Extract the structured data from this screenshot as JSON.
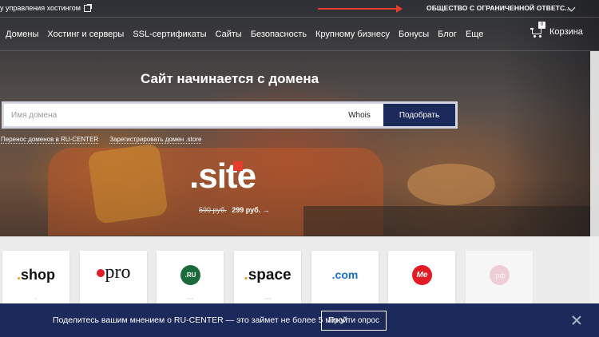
{
  "topbar": {
    "hosting_link": "у управления хостингом",
    "company": "ОБЩЕСТВО С ОГРАНИЧЕННОЙ ОТВЕТС..."
  },
  "nav": {
    "items": [
      "Домены",
      "Хостинг и серверы",
      "SSL-сертификаты",
      "Сайты",
      "Безопасность",
      "Крупному бизнесу",
      "Бонусы",
      "Блог",
      "Еще"
    ],
    "cart_label": "Корзина",
    "cart_count": "0"
  },
  "hero": {
    "headline": "Сайт начинается с домена",
    "search_placeholder": "Имя домена",
    "whois_label": "Whois",
    "pick_button": "Подобрать",
    "links": [
      "Перенос доменов в RU-CENTER",
      "Зарегистрировать домен .store"
    ]
  },
  "promo": {
    "zone_text": ".site",
    "old_price": "590 руб.",
    "new_price": "299 руб. →"
  },
  "tiles": [
    {
      "label": "shop",
      "prefix": "."
    },
    {
      "label": "pro",
      "prefix": ""
    },
    {
      "label": ".RU",
      "prefix": ""
    },
    {
      "label": "space",
      "prefix": "."
    },
    {
      "label": "com",
      "prefix": "."
    },
    {
      "label": "Me",
      "prefix": ""
    },
    {
      "label": ".рф",
      "prefix": ""
    }
  ],
  "banner": {
    "message": "Поделитесь вашим мнением о RU-CENTER — это займет не более 5 минут",
    "button": "Пройти опрос"
  },
  "colors": {
    "brand_navy": "#1b2a5a",
    "accent_red": "#e53c2e"
  }
}
